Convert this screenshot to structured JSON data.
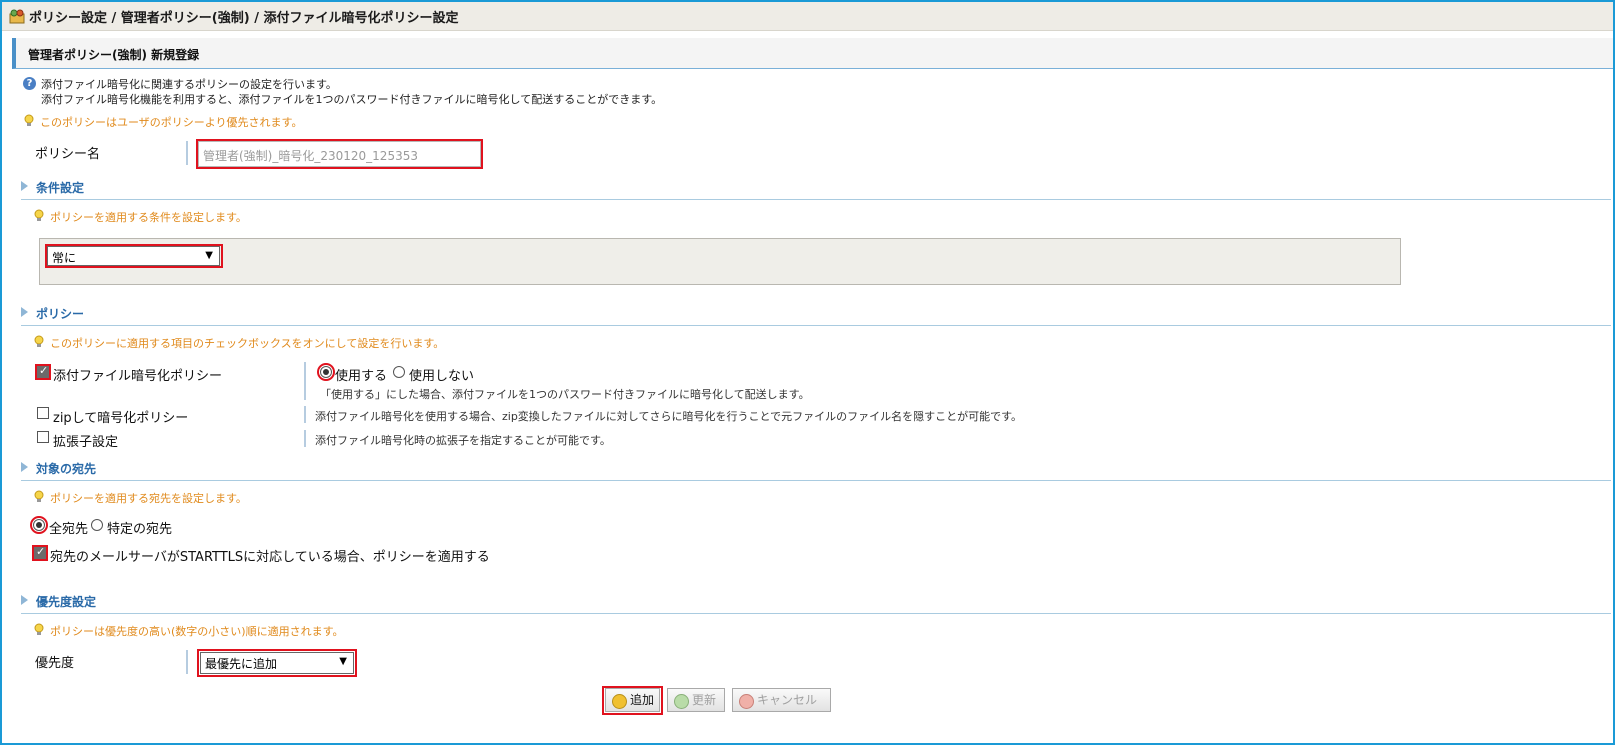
{
  "breadcrumb": "ポリシー設定 / 管理者ポリシー(強制) / 添付ファイル暗号化ポリシー設定",
  "page_title": "管理者ポリシー(強制) 新規登録",
  "intro": {
    "line1": "添付ファイル暗号化に関連するポリシーの設定を行います。",
    "line2": "添付ファイル暗号化機能を利用すると、添付ファイルを1つのパスワード付きファイルに暗号化して配送することができます。"
  },
  "priority_notice": "このポリシーはユーザのポリシーより優先されます。",
  "policy_name": {
    "label": "ポリシー名",
    "value": "管理者(強制)_暗号化_230120_125353"
  },
  "conditions": {
    "heading": "条件設定",
    "tip": "ポリシーを適用する条件を設定します。",
    "select_value": "常に"
  },
  "policy": {
    "heading": "ポリシー",
    "tip": "このポリシーに適用する項目のチェックボックスをオンにして設定を行います。",
    "encryption": {
      "label": "添付ファイル暗号化ポリシー",
      "checked": true,
      "use_label": "使用する",
      "nouse_label": "使用しない",
      "desc": "「使用する」にした場合、添付ファイルを1つのパスワード付きファイルに暗号化して配送します。"
    },
    "zip": {
      "label": "zipして暗号化ポリシー",
      "checked": false,
      "desc": "添付ファイル暗号化を使用する場合、zip変換したファイルに対してさらに暗号化を行うことで元ファイルのファイル名を隠すことが可能です。"
    },
    "extension": {
      "label": "拡張子設定",
      "checked": false,
      "desc": "添付ファイル暗号化時の拡張子を指定することが可能です。"
    }
  },
  "recipients": {
    "heading": "対象の宛先",
    "tip": "ポリシーを適用する宛先を設定します。",
    "all_label": "全宛先",
    "specific_label": "特定の宛先",
    "starttls_label": "宛先のメールサーバがSTARTTLSに対応している場合、ポリシーを適用する",
    "starttls_checked": true
  },
  "priority": {
    "heading": "優先度設定",
    "tip": "ポリシーは優先度の高い(数字の小さい)順に適用されます。",
    "label": "優先度",
    "select_value": "最優先に追加"
  },
  "buttons": {
    "add": "追加",
    "update": "更新",
    "cancel": "キャンセル"
  },
  "colors": {
    "frame_border": "#1a9ad6",
    "highlight_red": "#e0121e",
    "tip_orange": "#e08a1c",
    "section_blue": "#2a6aa8"
  }
}
